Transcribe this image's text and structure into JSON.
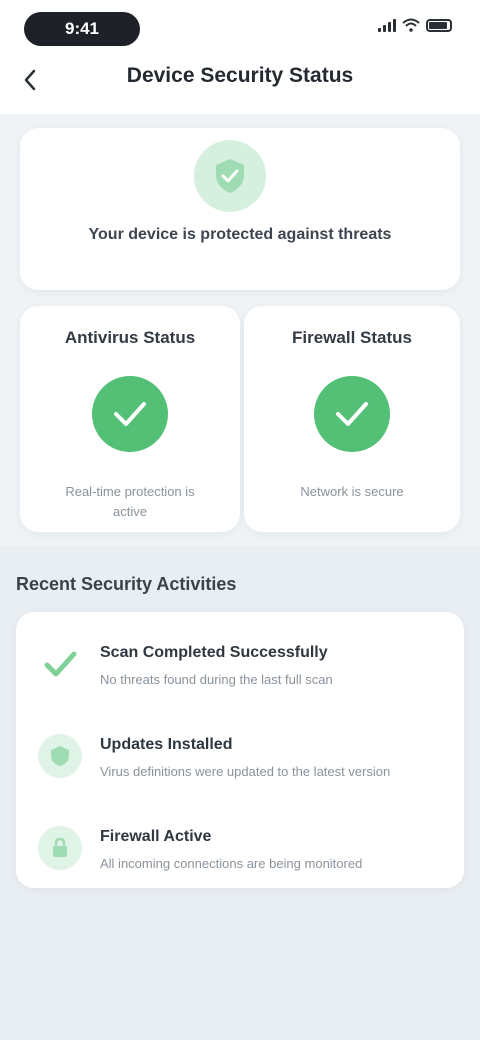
{
  "status_bar": {
    "time": "9:41"
  },
  "header": {
    "title": "Device Security Status"
  },
  "overview": {
    "text": "Your device is protected against threats"
  },
  "cards": [
    {
      "heading": "Antivirus Status",
      "caption": "Real-time protection is active"
    },
    {
      "heading": "Firewall Status",
      "caption": "Network is secure"
    }
  ],
  "recent": {
    "title": "Recent Security Activities",
    "items": [
      {
        "title": "Scan Completed Successfully",
        "desc": "No threats found during the last full scan",
        "icon": "check-icon"
      },
      {
        "title": "Updates Installed",
        "desc": "Virus definitions were updated to the latest version",
        "icon": "shield-icon"
      },
      {
        "title": "Firewall Active",
        "desc": "All incoming connections are being monitored",
        "icon": "lock-icon"
      }
    ]
  },
  "colors": {
    "accent": "#53c076",
    "accent_light": "#d6f0df",
    "background": "#e9eef3"
  }
}
